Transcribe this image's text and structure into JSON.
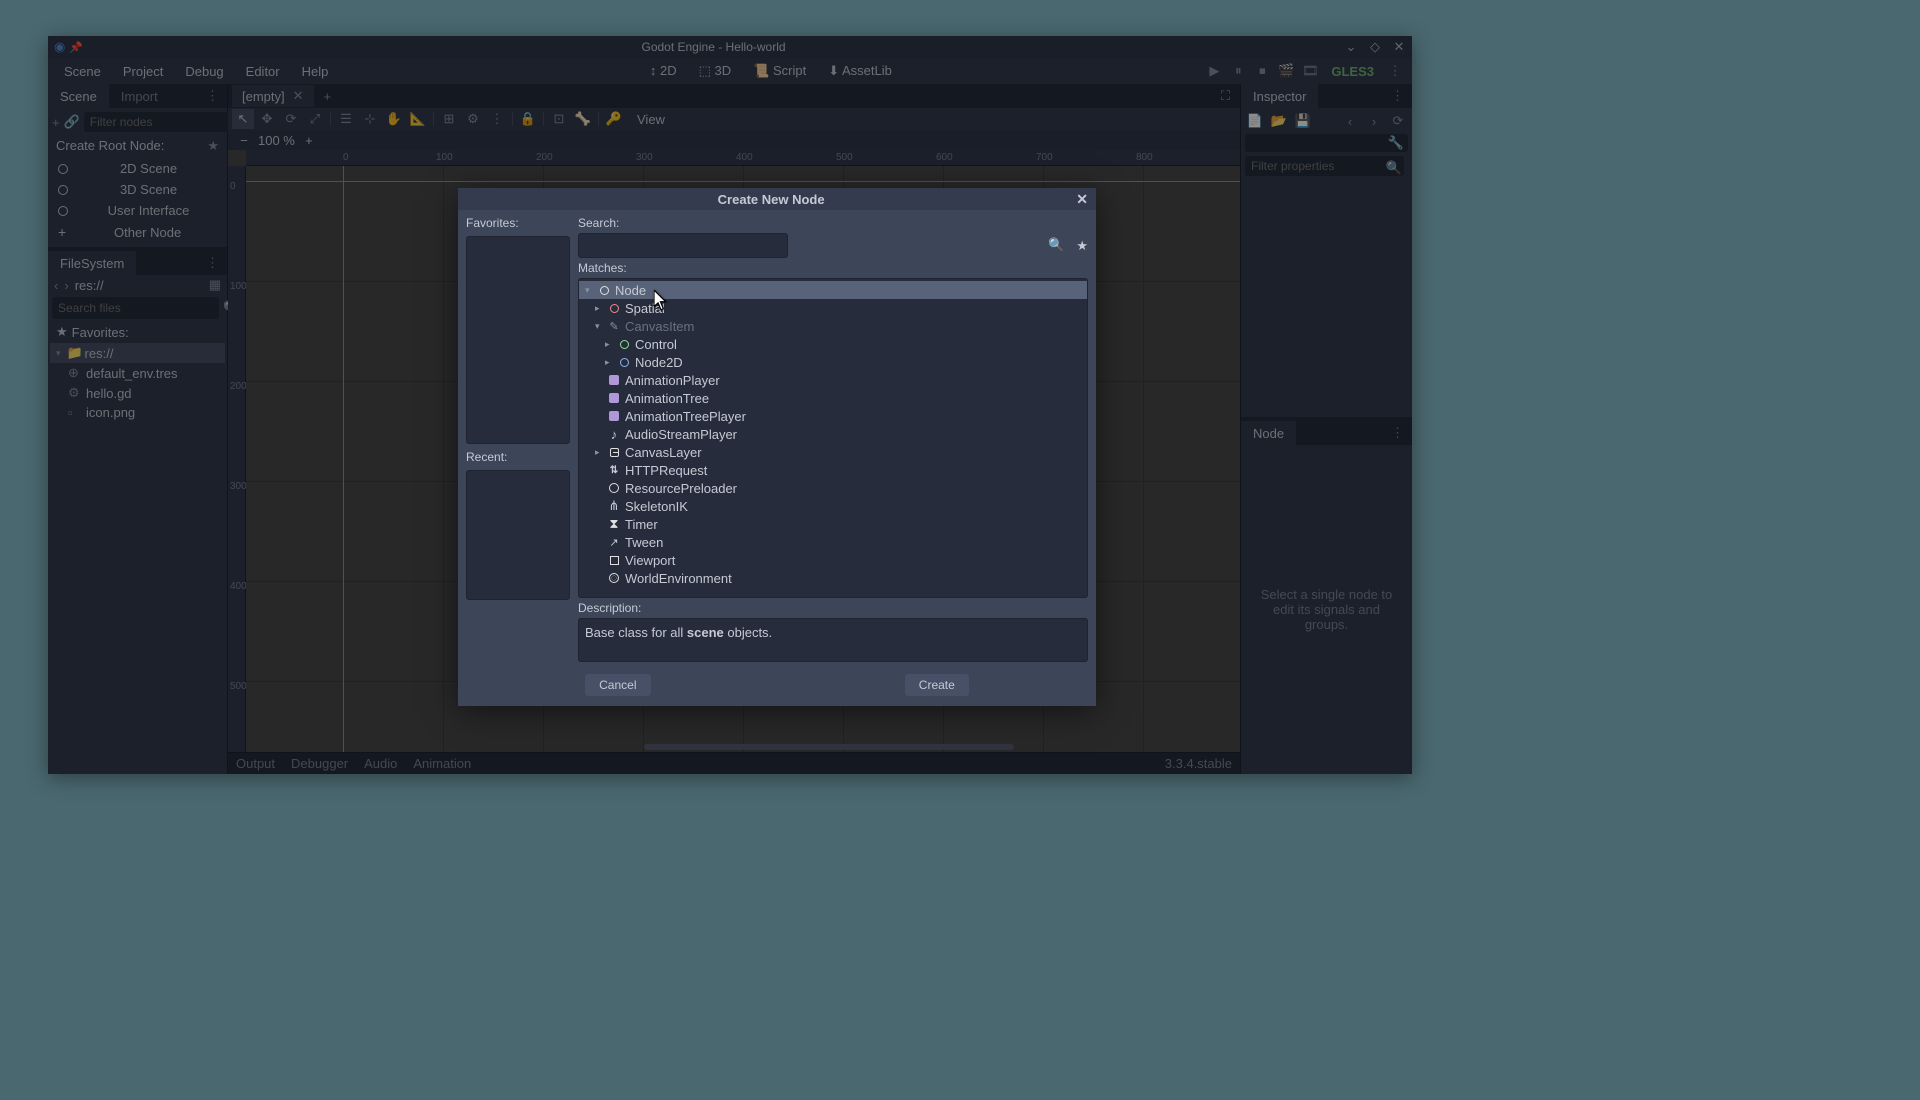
{
  "window": {
    "title": "Godot Engine - Hello-world"
  },
  "menubar": {
    "items": [
      "Scene",
      "Project",
      "Debug",
      "Editor",
      "Help"
    ],
    "modes": {
      "m2d": "2D",
      "m3d": "3D",
      "script": "Script",
      "assetlib": "AssetLib"
    },
    "renderer": "GLES3"
  },
  "scene_dock": {
    "tabs": {
      "scene": "Scene",
      "import": "Import"
    },
    "filter_placeholder": "Filter nodes",
    "root_label": "Create Root Node:",
    "btn_2d": "2D Scene",
    "btn_3d": "3D Scene",
    "btn_ui": "User Interface",
    "btn_other": "Other Node"
  },
  "filesystem": {
    "title": "FileSystem",
    "path": "res://",
    "search_placeholder": "Search files",
    "favorites_label": "Favorites:",
    "root": "res://",
    "files": [
      "default_env.tres",
      "hello.gd",
      "icon.png"
    ]
  },
  "editor": {
    "tab": "[empty]",
    "view": "View",
    "zoom": "100 %"
  },
  "inspector": {
    "title": "Inspector",
    "filter_placeholder": "Filter properties"
  },
  "node_dock": {
    "title": "Node",
    "empty": "Select a single node to edit its signals and groups."
  },
  "bottom": {
    "items": [
      "Output",
      "Debugger",
      "Audio",
      "Animation"
    ],
    "version": "3.3.4.stable"
  },
  "dialog": {
    "title": "Create New Node",
    "favorites": "Favorites:",
    "recent": "Recent:",
    "search": "Search:",
    "matches": "Matches:",
    "description_label": "Description:",
    "description_pre": "Base class for all ",
    "description_h": "scene",
    "description_post": " objects.",
    "cancel": "Cancel",
    "create": "Create",
    "tree": [
      {
        "indent": 0,
        "arr": "▾",
        "ic": "node",
        "label": "Node",
        "sel": true
      },
      {
        "indent": 1,
        "arr": "▸",
        "ic": "spatial",
        "label": "Spatial"
      },
      {
        "indent": 1,
        "arr": "▾",
        "ic": "canvas",
        "label": "CanvasItem",
        "disabled": true
      },
      {
        "indent": 2,
        "arr": "▸",
        "ic": "control",
        "label": "Control"
      },
      {
        "indent": 2,
        "arr": "▸",
        "ic": "node2d",
        "label": "Node2D"
      },
      {
        "indent": 1,
        "arr": "",
        "ic": "anim",
        "label": "AnimationPlayer"
      },
      {
        "indent": 1,
        "arr": "",
        "ic": "anim",
        "label": "AnimationTree"
      },
      {
        "indent": 1,
        "arr": "",
        "ic": "anim",
        "label": "AnimationTreePlayer"
      },
      {
        "indent": 1,
        "arr": "",
        "ic": "audio",
        "label": "AudioStreamPlayer"
      },
      {
        "indent": 1,
        "arr": "▸",
        "ic": "layer",
        "label": "CanvasLayer"
      },
      {
        "indent": 1,
        "arr": "",
        "ic": "http",
        "label": "HTTPRequest"
      },
      {
        "indent": 1,
        "arr": "",
        "ic": "preload",
        "label": "ResourcePreloader"
      },
      {
        "indent": 1,
        "arr": "",
        "ic": "skel",
        "label": "SkeletonIK"
      },
      {
        "indent": 1,
        "arr": "",
        "ic": "timer",
        "label": "Timer"
      },
      {
        "indent": 1,
        "arr": "",
        "ic": "tween",
        "label": "Tween"
      },
      {
        "indent": 1,
        "arr": "",
        "ic": "view",
        "label": "Viewport"
      },
      {
        "indent": 1,
        "arr": "",
        "ic": "world",
        "label": "WorldEnvironment"
      }
    ]
  }
}
